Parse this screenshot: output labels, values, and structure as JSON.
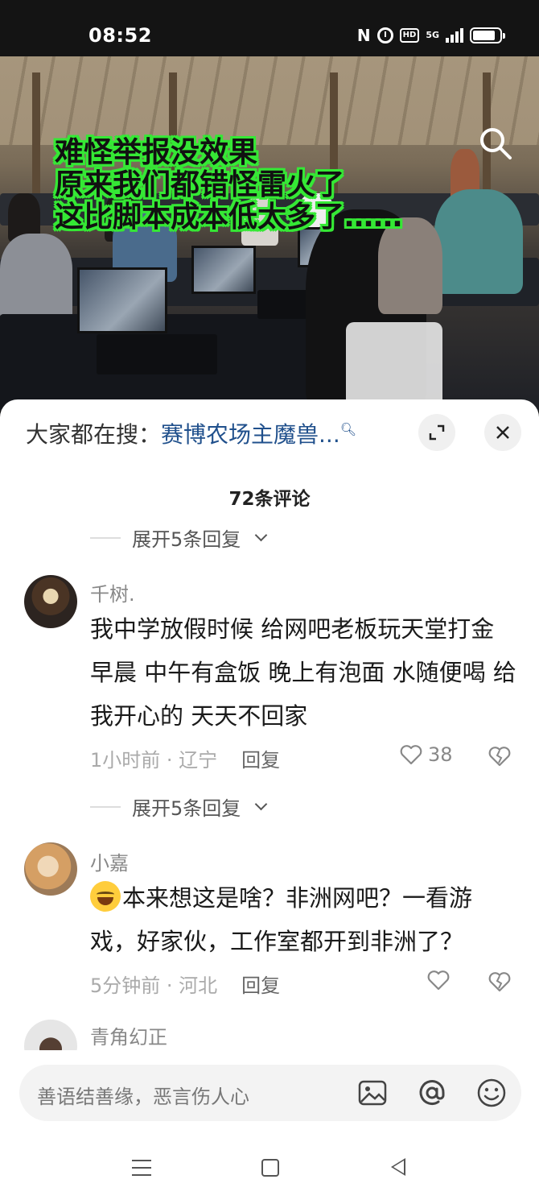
{
  "status_bar": {
    "time": "08:52",
    "nfc": "N",
    "hd": "HD",
    "network": "5G",
    "battery_level": 0.85
  },
  "media": {
    "caption_lines": [
      "难怪举报没效果",
      "原来我们都错怪雷火了",
      "这比脚本成本低太多了……"
    ],
    "search_icon": "search-icon"
  },
  "trending": {
    "prefix": "大家都在搜：",
    "keyword": "赛博农场主魔兽...",
    "expand_icon": "expand-icon",
    "close_icon": "close-icon"
  },
  "comments_header": {
    "count_label": "72条评论"
  },
  "expand_replies_label": "展开5条回复",
  "comments": [
    {
      "username": "千树.",
      "text": "我中学放假时候 给网吧老板玩天堂打金 早晨 中午有盒饭 晚上有泡面 水随便喝 给我开心的 天天不回家",
      "time": "1小时前",
      "location": "辽宁",
      "reply_label": "回复",
      "likes": "38"
    },
    {
      "username": "小嘉",
      "text": "本来想这是啥？非洲网吧？一看游戏，好家伙，工作室都开到非洲了？",
      "time": "5分钟前",
      "location": "河北",
      "reply_label": "回复",
      "likes": ""
    },
    {
      "username": "青角幻正"
    }
  ],
  "input_bar": {
    "placeholder": "善语结善缘，恶言伤人心",
    "icons": [
      "image-icon",
      "at-icon",
      "emoji-icon"
    ]
  },
  "colors": {
    "caption_outline": "#35e835",
    "link_blue": "#20508c"
  }
}
